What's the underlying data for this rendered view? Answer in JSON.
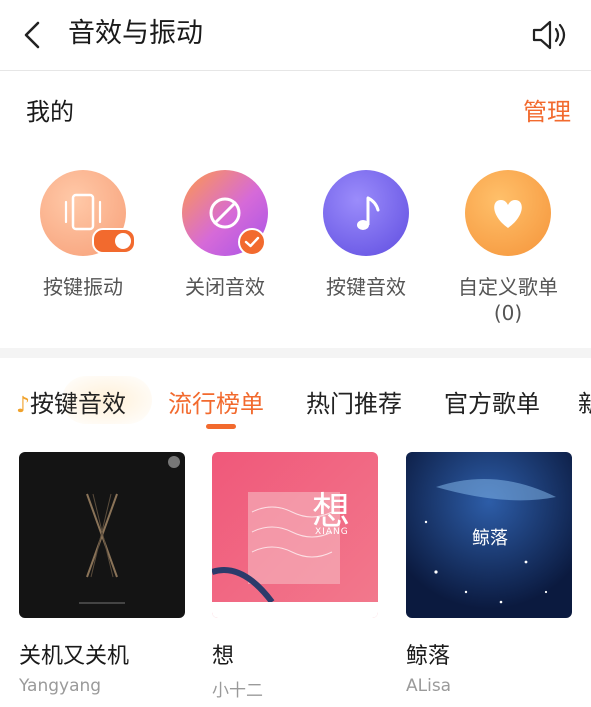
{
  "header": {
    "title": "音效与振动",
    "back_icon": "back-chevron-icon",
    "speaker_icon": "speaker-icon"
  },
  "mine": {
    "title": "我的",
    "manage_label": "管理",
    "items": [
      {
        "label": "按键振动",
        "icon": "phone-vibrate-icon",
        "sub": ""
      },
      {
        "label": "关闭音效",
        "icon": "ban-icon",
        "sub": ""
      },
      {
        "label": "按键音效",
        "icon": "music-note-icon",
        "sub": ""
      },
      {
        "label": "自定义歌单",
        "icon": "heart-icon",
        "sub": "(0)"
      }
    ]
  },
  "tabs": [
    {
      "label": "按键音效",
      "prefix": "♪",
      "active": false
    },
    {
      "label": "流行榜单",
      "active": true
    },
    {
      "label": "热门推荐",
      "active": false
    },
    {
      "label": "官方歌单",
      "active": false
    },
    {
      "label": "新",
      "active": false
    }
  ],
  "albums": [
    {
      "title": "关机又关机",
      "artist": "Yangyang"
    },
    {
      "title": "想",
      "artist": "小十二",
      "cover_text": "想",
      "cover_sub": "XIANG"
    },
    {
      "title": "鲸落",
      "artist": "ALisa",
      "cover_text": "鲸落"
    }
  ],
  "colors": {
    "accent": "#f26a2e"
  }
}
